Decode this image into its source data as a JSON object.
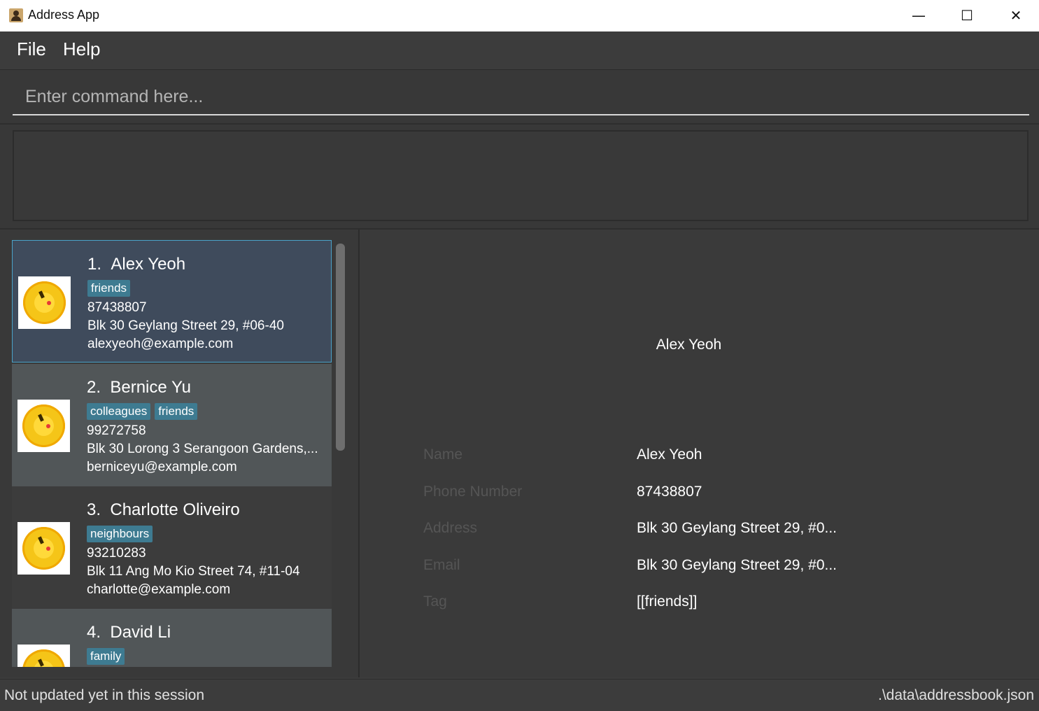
{
  "window": {
    "title": "Address App",
    "minimize_glyph": "—",
    "maximize_glyph": "☐",
    "close_glyph": "✕"
  },
  "menu": {
    "items": [
      "File",
      "Help"
    ]
  },
  "command": {
    "placeholder": "Enter command here...",
    "value": ""
  },
  "result": {
    "text": ""
  },
  "persons": [
    {
      "index": "1.",
      "name": "Alex Yeoh",
      "tags": [
        "friends"
      ],
      "phone": "87438807",
      "address": "Blk 30 Geylang Street 29, #06-40",
      "email": "alexyeoh@example.com",
      "selected": true
    },
    {
      "index": "2.",
      "name": "Bernice Yu",
      "tags": [
        "colleagues",
        "friends"
      ],
      "phone": "99272758",
      "address": "Blk 30 Lorong 3 Serangoon Gardens,...",
      "email": "berniceyu@example.com",
      "selected": false
    },
    {
      "index": "3.",
      "name": "Charlotte Oliveiro",
      "tags": [
        "neighbours"
      ],
      "phone": "93210283",
      "address": "Blk 11 Ang Mo Kio Street 74, #11-04",
      "email": "charlotte@example.com",
      "selected": false
    },
    {
      "index": "4.",
      "name": "David Li",
      "tags": [
        "family"
      ],
      "phone": "",
      "address": "",
      "email": "",
      "selected": false
    }
  ],
  "detail": {
    "title": "Alex Yeoh",
    "rows": [
      {
        "label": "Name",
        "value": "Alex Yeoh"
      },
      {
        "label": "Phone Number",
        "value": "87438807"
      },
      {
        "label": "Address",
        "value": "Blk 30 Geylang Street 29, #0..."
      },
      {
        "label": "Email",
        "value": "Blk 30 Geylang Street 29, #0..."
      },
      {
        "label": "Tag",
        "value": "[[friends]]"
      }
    ]
  },
  "status": {
    "left": "Not updated yet in this session",
    "right": ".\\data\\addressbook.json"
  },
  "colors": {
    "background": "#3c3c3c",
    "selected_card": "#3f4b5c",
    "selected_border": "#4aa3c9",
    "tag": "#3e7b91"
  }
}
